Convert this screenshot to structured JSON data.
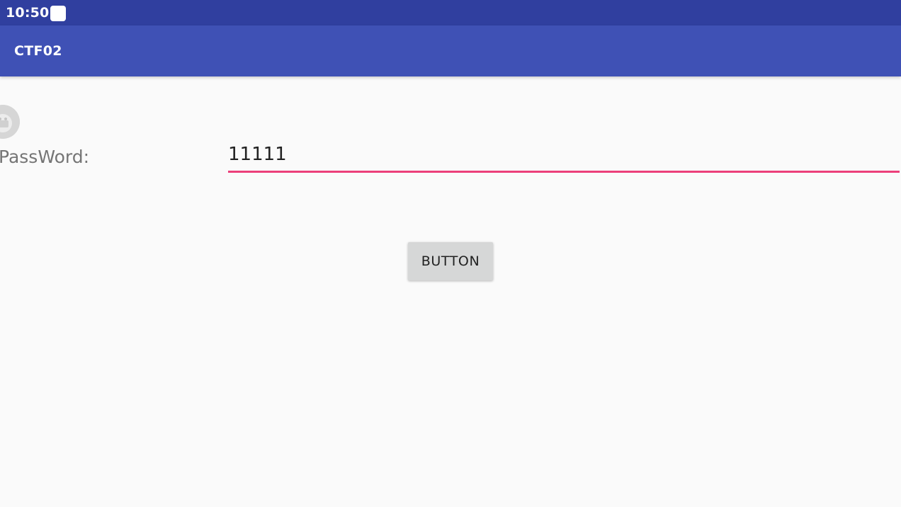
{
  "status_bar": {
    "time": "10:50",
    "notification_icon": "square-notification-icon"
  },
  "app_bar": {
    "title": "CTF02",
    "color": "#3f51b5"
  },
  "form": {
    "icon": "android-app-icon",
    "password_label": "PassWord:",
    "password_value": "11111",
    "accent_color": "#ec407a"
  },
  "actions": {
    "button_label": "BUTTON"
  }
}
